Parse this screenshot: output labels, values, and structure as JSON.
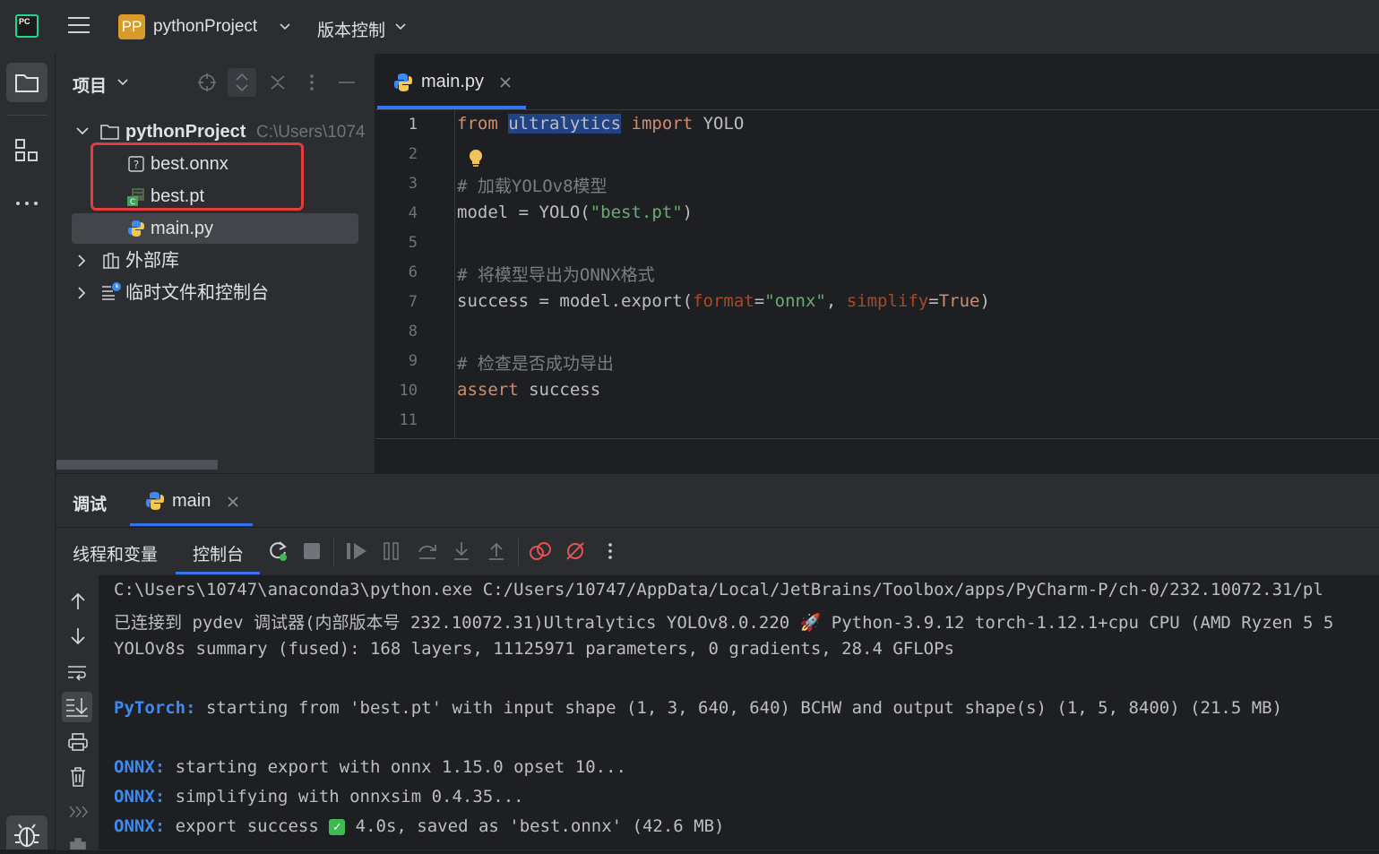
{
  "titlebar": {
    "app_logo": "PC",
    "project_badge": "PP",
    "project_name": "pythonProject",
    "vcs_label": "版本控制"
  },
  "project_panel": {
    "title": "项目",
    "tree": {
      "root_name": "pythonProject",
      "root_path": "C:\\Users\\1074",
      "files": [
        {
          "name": "best.onnx",
          "icon": "unknown-file-icon"
        },
        {
          "name": "best.pt",
          "icon": "binary-file-icon"
        },
        {
          "name": "main.py",
          "icon": "python-file-icon"
        }
      ],
      "external_libraries": "外部库",
      "scratches": "临时文件和控制台"
    }
  },
  "editor": {
    "tab_label": "main.py",
    "line_numbers": [
      "1",
      "2",
      "3",
      "4",
      "5",
      "6",
      "7",
      "8",
      "9",
      "10",
      "11"
    ],
    "code": {
      "l1_from": "from",
      "l1_module": "ultralytics",
      "l1_import": "import",
      "l1_name": "YOLO",
      "l3_comment": "# 加载YOLOv8模型",
      "l4_a": "model = YOLO(",
      "l4_str": "\"best.pt\"",
      "l4_b": ")",
      "l6_comment": "# 将模型导出为ONNX格式",
      "l7_a": "success = model.export(",
      "l7_p1": "format",
      "l7_eq1": "=",
      "l7_s1": "\"onnx\"",
      "l7_comma": ", ",
      "l7_p2": "simplify",
      "l7_eq2": "=",
      "l7_true": "True",
      "l7_b": ")",
      "l9_comment": "# 检查是否成功导出",
      "l10_kw": "assert",
      "l10_rest": " success"
    }
  },
  "debug_panel": {
    "title": "调试",
    "run_tab": "main",
    "subtabs": [
      "线程和变量",
      "控制台"
    ],
    "console": {
      "line1": "C:\\Users\\10747\\anaconda3\\python.exe C:/Users/10747/AppData/Local/JetBrains/Toolbox/apps/PyCharm-P/ch-0/232.10072.31/pl",
      "line2a": "已连接到 pydev 调试器(内部版本号 232.10072.31)Ultralytics YOLOv8.0.220 ",
      "line2_emoji": "🚀",
      "line2b": " Python-3.9.12 torch-1.12.1+cpu CPU (AMD Ryzen 5 5",
      "line3": "YOLOv8s summary (fused): 168 layers, 11125971 parameters, 0 gradients, 28.4 GFLOPs",
      "pytorch_prefix": "PyTorch:",
      "line5": " starting from 'best.pt' with input shape (1, 3, 640, 640) BCHW and output shape(s) (1, 5, 8400) (21.5 MB)",
      "onnx_prefix": "ONNX:",
      "line7": " starting export with onnx 1.15.0 opset 10...",
      "line8": " simplifying with onnxsim 0.4.35...",
      "line9a": " export success ",
      "line9_check": "✓",
      "line9b": " 4.0s, saved as 'best.onnx' (42.6 MB)"
    }
  },
  "colors": {
    "accent": "#3574f0",
    "highlight_box": "#e8393d",
    "keyword": "#cf8e6d",
    "string": "#6aab73",
    "onnx_label": "#3d8bf0"
  }
}
